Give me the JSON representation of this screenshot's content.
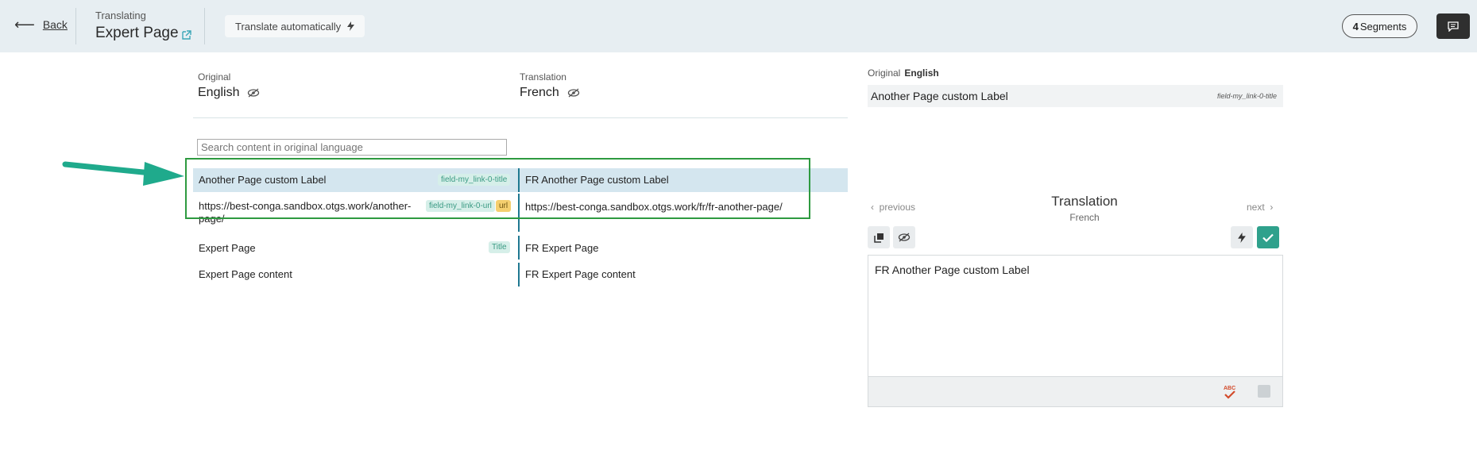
{
  "topbar": {
    "back_label": "Back",
    "translating_label": "Translating",
    "page_title": "Expert Page",
    "translate_auto_label": "Translate automatically",
    "segments_count": "4",
    "segments_label": "Segments"
  },
  "columns": {
    "original_label": "Original",
    "original_lang": "English",
    "translation_label": "Translation",
    "translation_lang": "French"
  },
  "search": {
    "placeholder": "Search content in original language"
  },
  "segments": [
    {
      "source": "Another Page custom Label",
      "tags": [
        "field-my_link-0-title"
      ],
      "target": "FR Another Page custom Label"
    },
    {
      "source_line1": "https://best-conga.sandbox.otgs.work/another-",
      "source_line2": "page/",
      "tags": [
        "field-my_link-0-url",
        "url"
      ],
      "target": "https://best-conga.sandbox.otgs.work/fr/fr-another-page/"
    },
    {
      "source": "Expert Page",
      "tags": [
        "Title"
      ],
      "target": "FR Expert Page"
    },
    {
      "source": "Expert Page content",
      "tags": [],
      "target": "FR Expert Page content"
    }
  ],
  "right_panel": {
    "original_label": "Original",
    "original_lang": "English",
    "original_text": "Another Page custom Label",
    "original_field": "field-my_link-0-title",
    "prev_label": "previous",
    "next_label": "next",
    "translation_title": "Translation",
    "translation_lang": "French",
    "editor_text": "FR Another Page custom Label"
  },
  "colors": {
    "topbar_bg": "#e7eef2",
    "selected_row": "#d4e6ef",
    "accent_teal": "#2fa18c",
    "highlight_green": "#2e9a40",
    "url_tag": "#f5cf6f"
  }
}
